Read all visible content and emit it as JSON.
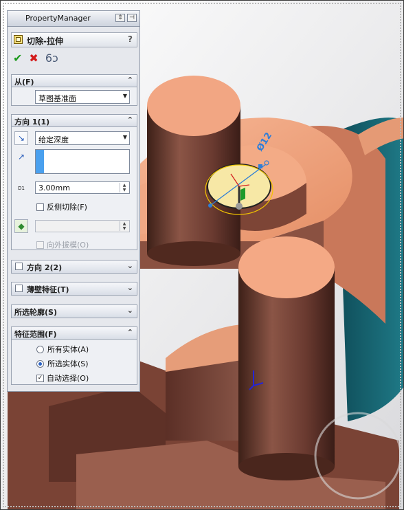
{
  "property_manager": {
    "title": "PropertyManager",
    "feature_title": "切除-拉伸",
    "help": "?",
    "actions": {
      "ok": "✔",
      "cancel": "✖",
      "preview": "6ɔ"
    }
  },
  "from_group": {
    "label": "从(F)",
    "chevron": "⌃",
    "value": "草图基准面"
  },
  "direction1": {
    "label": "方向 1(1)",
    "chevron": "⌃",
    "end_condition": "给定深度",
    "depth": "3.00mm",
    "depth_prefix": "D1",
    "flip_side": "反侧切除(F)",
    "draft_value": "",
    "draft_outward": "向外拔模(O)"
  },
  "direction2": {
    "label": "方向 2(2)",
    "chevron": "⌄"
  },
  "thin_feature": {
    "label": "薄壁特征(T)",
    "chevron": "⌄"
  },
  "selected_contours": {
    "label": "所选轮廓(S)",
    "chevron": "⌄"
  },
  "feature_scope": {
    "label": "特征范围(F)",
    "chevron": "⌃",
    "all_bodies": "所有实体(A)",
    "selected_bodies": "所选实体(S)",
    "auto_select": "自动选择(O)",
    "auto_select_checked": "✓"
  },
  "viewport": {
    "dimension_text": "Ø12",
    "colors": {
      "copper_light": "#f1a57f",
      "copper_dark": "#6a3a30",
      "teal": "#1d6f7c",
      "sketch_yellow": "#f7e8a6"
    }
  }
}
